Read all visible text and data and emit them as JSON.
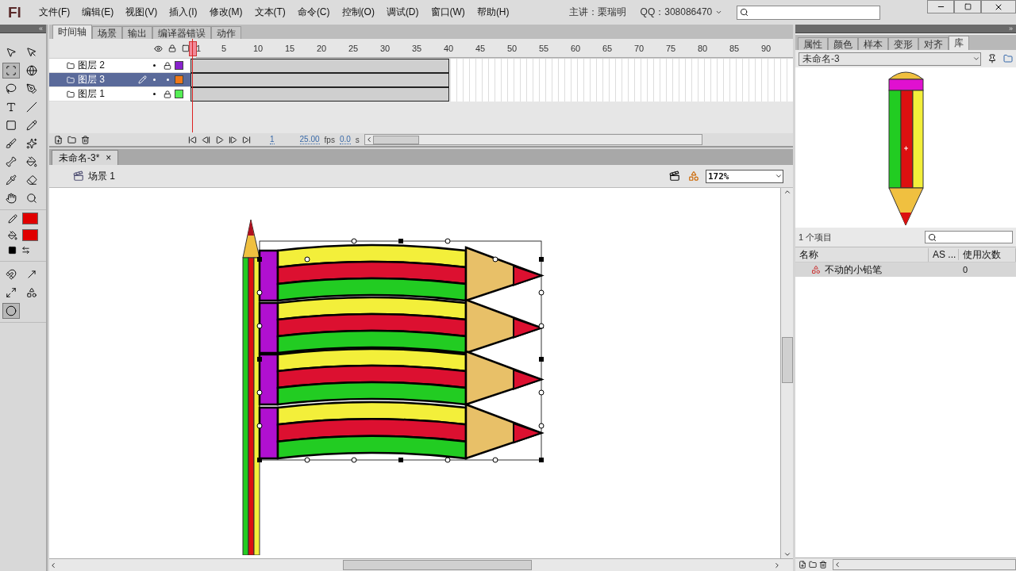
{
  "menu_bar": {
    "logo": "Fl",
    "items": [
      "文件(F)",
      "编辑(E)",
      "视图(V)",
      "插入(I)",
      "修改(M)",
      "文本(T)",
      "命令(C)",
      "控制(O)",
      "调试(D)",
      "窗口(W)",
      "帮助(H)"
    ],
    "presenter": "主讲：栗瑞明",
    "qq": "QQ：308086470"
  },
  "toolbox": {
    "collapse": "«",
    "tools": [
      {
        "kind": "selection",
        "selected": false
      },
      {
        "kind": "subselection",
        "selected": false
      },
      {
        "kind": "transform",
        "selected": true
      },
      {
        "kind": "rotate3d",
        "selected": false
      },
      {
        "kind": "lasso",
        "selected": false
      },
      {
        "kind": "pen",
        "selected": false
      },
      {
        "kind": "text",
        "selected": false
      },
      {
        "kind": "line",
        "selected": false
      },
      {
        "kind": "rect",
        "selected": false
      },
      {
        "kind": "pencil",
        "selected": false
      },
      {
        "kind": "brush",
        "selected": false
      },
      {
        "kind": "deco",
        "selected": false
      },
      {
        "kind": "bone",
        "selected": false
      },
      {
        "kind": "bucket",
        "selected": false
      },
      {
        "kind": "eyedropper",
        "selected": false
      },
      {
        "kind": "eraser",
        "selected": false
      },
      {
        "kind": "hand",
        "selected": false
      },
      {
        "kind": "zoom",
        "selected": false
      }
    ],
    "colors": [
      {
        "kind": "stroke",
        "color": "#e00000"
      },
      {
        "kind": "fill",
        "color": "#e00000"
      }
    ],
    "options": [
      {
        "kind": "snap",
        "selected": false
      },
      {
        "kind": "skew",
        "selected": false
      },
      {
        "kind": "scale",
        "selected": false
      },
      {
        "kind": "distort",
        "selected": false
      },
      {
        "kind": "envelope",
        "selected": true
      }
    ]
  },
  "timeline": {
    "tabs": [
      {
        "label": "时间轴",
        "selected": true
      },
      {
        "label": "场景",
        "selected": false
      },
      {
        "label": "输出",
        "selected": false
      },
      {
        "label": "编译器错误",
        "selected": false
      },
      {
        "label": "动作",
        "selected": false
      }
    ],
    "frame_labels": [
      "1",
      "5",
      "10",
      "15",
      "20",
      "25",
      "30",
      "35",
      "40",
      "45",
      "50",
      "55",
      "60",
      "65",
      "70",
      "75",
      "80",
      "85",
      "90"
    ],
    "layers": [
      {
        "name": "图层 2",
        "selected": false,
        "locked": true,
        "editing": false,
        "color": "#8822cc"
      },
      {
        "name": "图层 3",
        "selected": true,
        "locked": false,
        "editing": true,
        "color": "#f07818"
      },
      {
        "name": "图层 1",
        "selected": false,
        "locked": true,
        "editing": false,
        "color": "#55ee55"
      }
    ],
    "controls": {
      "frame": "1",
      "fps": "25.00",
      "fps_unit": "fps",
      "time": "0.0",
      "time_unit": "s"
    }
  },
  "document": {
    "tab": "未命名-3*",
    "close": "×",
    "scene": "场景 1",
    "zoom": "172%"
  },
  "library_panel": {
    "collapse": "»",
    "tabs": [
      {
        "label": "属性",
        "selected": false
      },
      {
        "label": "颜色",
        "selected": false
      },
      {
        "label": "样本",
        "selected": false
      },
      {
        "label": "变形",
        "selected": false
      },
      {
        "label": "对齐",
        "selected": false
      },
      {
        "label": "库",
        "selected": true
      }
    ],
    "library": "未命名-3",
    "item_count": "1 个项目",
    "columns": [
      "名称",
      "AS ...",
      "使用次数"
    ],
    "items": [
      {
        "name": "不动的小铅笔",
        "uses": "0"
      }
    ]
  }
}
